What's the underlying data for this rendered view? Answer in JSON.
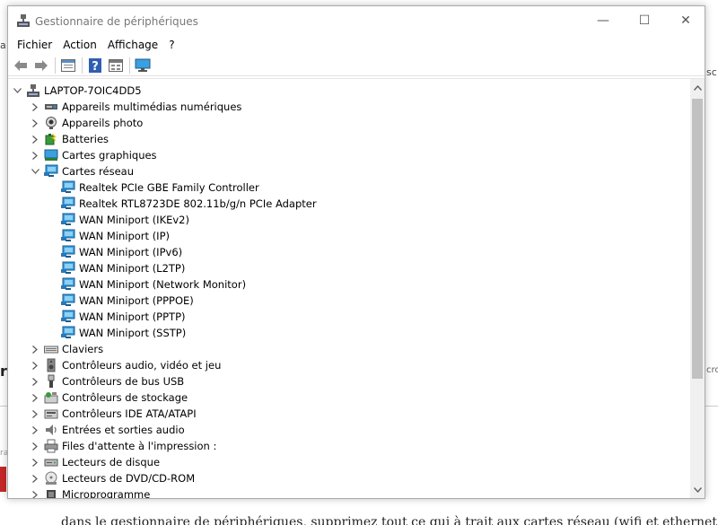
{
  "window": {
    "title": "Gestionnaire de périphériques",
    "minimize_glyph": "—",
    "maximize_glyph": "☐",
    "close_glyph": "✕"
  },
  "menu": [
    "Fichier",
    "Action",
    "Affichage",
    "?"
  ],
  "toolbar": {
    "buttons": [
      "back-arrow-icon",
      "forward-arrow-icon",
      "properties-pane-icon",
      "help-icon",
      "details-view-icon",
      "monitor-scan-icon"
    ]
  },
  "tree": {
    "root": "LAPTOP-7OIC4DD5",
    "items": [
      {
        "label": "Appareils multimédias numériques",
        "icon": "multimedia-device-icon",
        "level": 1,
        "expander": "collapsed"
      },
      {
        "label": "Appareils photo",
        "icon": "camera-icon",
        "level": 1,
        "expander": "collapsed"
      },
      {
        "label": "Batteries",
        "icon": "battery-icon",
        "level": 1,
        "expander": "collapsed"
      },
      {
        "label": "Cartes graphiques",
        "icon": "display-adapter-icon",
        "level": 1,
        "expander": "collapsed"
      },
      {
        "label": "Cartes réseau",
        "icon": "network-adapter-icon",
        "level": 1,
        "expander": "expanded"
      },
      {
        "label": "Realtek PCIe GBE Family Controller",
        "icon": "network-adapter-icon",
        "level": 2,
        "expander": "none"
      },
      {
        "label": "Realtek RTL8723DE 802.11b/g/n PCIe Adapter",
        "icon": "network-adapter-icon",
        "level": 2,
        "expander": "none"
      },
      {
        "label": "WAN Miniport (IKEv2)",
        "icon": "network-adapter-icon",
        "level": 2,
        "expander": "none"
      },
      {
        "label": "WAN Miniport (IP)",
        "icon": "network-adapter-icon",
        "level": 2,
        "expander": "none"
      },
      {
        "label": "WAN Miniport (IPv6)",
        "icon": "network-adapter-icon",
        "level": 2,
        "expander": "none"
      },
      {
        "label": "WAN Miniport (L2TP)",
        "icon": "network-adapter-icon",
        "level": 2,
        "expander": "none"
      },
      {
        "label": "WAN Miniport (Network Monitor)",
        "icon": "network-adapter-icon",
        "level": 2,
        "expander": "none"
      },
      {
        "label": "WAN Miniport (PPPOE)",
        "icon": "network-adapter-icon",
        "level": 2,
        "expander": "none"
      },
      {
        "label": "WAN Miniport (PPTP)",
        "icon": "network-adapter-icon",
        "level": 2,
        "expander": "none"
      },
      {
        "label": "WAN Miniport (SSTP)",
        "icon": "network-adapter-icon",
        "level": 2,
        "expander": "none"
      },
      {
        "label": "Claviers",
        "icon": "keyboard-icon",
        "level": 1,
        "expander": "collapsed"
      },
      {
        "label": "Contrôleurs audio, vidéo et jeu",
        "icon": "speaker-icon",
        "level": 1,
        "expander": "collapsed"
      },
      {
        "label": "Contrôleurs de bus USB",
        "icon": "usb-icon",
        "level": 1,
        "expander": "collapsed"
      },
      {
        "label": "Contrôleurs de stockage",
        "icon": "storage-controller-icon",
        "level": 1,
        "expander": "collapsed"
      },
      {
        "label": "Contrôleurs IDE ATA/ATAPI",
        "icon": "ide-controller-icon",
        "level": 1,
        "expander": "collapsed"
      },
      {
        "label": "Entrées et sorties audio",
        "icon": "audio-io-icon",
        "level": 1,
        "expander": "collapsed"
      },
      {
        "label": "Files d'attente à l'impression :",
        "icon": "print-queue-icon",
        "level": 1,
        "expander": "collapsed"
      },
      {
        "label": "Lecteurs de disque",
        "icon": "disk-drive-icon",
        "level": 1,
        "expander": "collapsed"
      },
      {
        "label": "Lecteurs de DVD/CD-ROM",
        "icon": "dvd-drive-icon",
        "level": 1,
        "expander": "collapsed"
      },
      {
        "label": "Microprogramme",
        "icon": "firmware-icon",
        "level": 1,
        "expander": "collapsed"
      }
    ]
  },
  "background": {
    "left_fragments": [
      "a",
      "r",
      "ra"
    ],
    "right_fragments": [
      "sc",
      "cro"
    ],
    "bottom_text": "dans le gestionnaire de périphériques, supprimez tout ce qui à trait aux cartes réseau (wifi et ethernet)"
  },
  "colors": {
    "network_blue": "#1e88c8",
    "monitor_screen": "#3aa0e0",
    "scroll_thumb": "#c1c1c1"
  }
}
